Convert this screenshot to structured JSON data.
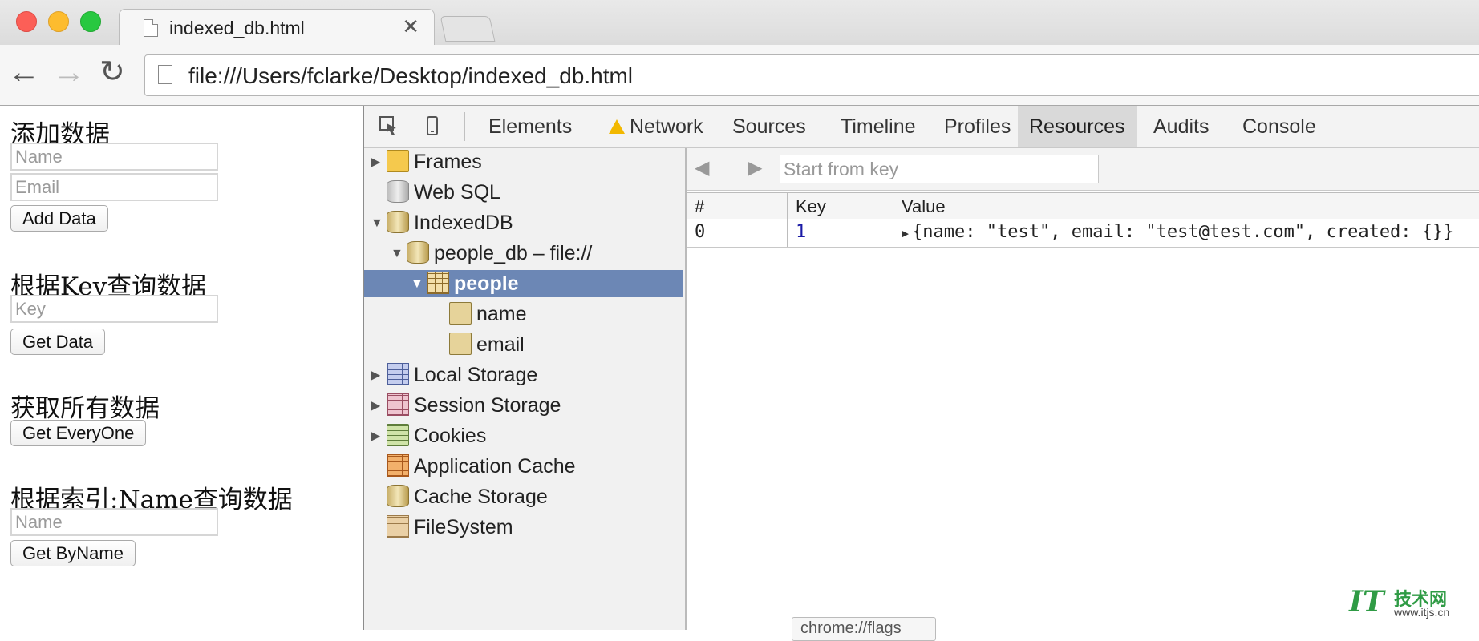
{
  "browser": {
    "tab_title": "indexed_db.html",
    "tab_close": "✕",
    "url": "file:///Users/fclarke/Desktop/indexed_db.html"
  },
  "page": {
    "sections": [
      {
        "heading": "添加数据"
      },
      {
        "heading": "根据Key查询数据"
      },
      {
        "heading": "获取所有数据"
      },
      {
        "heading": "根据索引:Name查询数据"
      }
    ],
    "add_name_placeholder": "Name",
    "add_email_placeholder": "Email",
    "add_button": "Add Data",
    "key_placeholder": "Key",
    "get_button": "Get Data",
    "everyone_button": "Get EveryOne",
    "byname_placeholder": "Name",
    "byname_button": "Get ByName"
  },
  "devtools": {
    "tabs": [
      "Elements",
      "Network",
      "Sources",
      "Timeline",
      "Profiles",
      "Resources",
      "Audits",
      "Console"
    ],
    "active_tab": "Resources",
    "network_warning": true,
    "tree": [
      {
        "label": "Frames",
        "icon": "folder-icon",
        "expanded": false
      },
      {
        "label": "Web SQL",
        "icon": "database-icon"
      },
      {
        "label": "IndexedDB",
        "icon": "database-icon",
        "expanded": true
      },
      {
        "label": "people_db – file://",
        "icon": "database-icon",
        "expanded": true
      },
      {
        "label": "people",
        "icon": "object-store-icon",
        "expanded": true,
        "selected": true
      },
      {
        "label": "name",
        "icon": "index-icon"
      },
      {
        "label": "email",
        "icon": "index-icon"
      },
      {
        "label": "Local Storage",
        "icon": "local-storage-icon",
        "expanded": false
      },
      {
        "label": "Session Storage",
        "icon": "session-storage-icon",
        "expanded": false
      },
      {
        "label": "Cookies",
        "icon": "cookie-icon",
        "expanded": false
      },
      {
        "label": "Application Cache",
        "icon": "app-cache-icon"
      },
      {
        "label": "Cache Storage",
        "icon": "database-icon"
      },
      {
        "label": "FileSystem",
        "icon": "filesystem-icon"
      }
    ],
    "filter_placeholder": "Start from key",
    "grid": {
      "columns": [
        "#",
        "Key",
        "Value"
      ],
      "rows": [
        {
          "index": "0",
          "key": "1",
          "value": "{name: \"test\", email: \"test@test.com\", created: {}}"
        }
      ]
    }
  },
  "tooltip": "chrome://flags",
  "watermark": {
    "logo": "IT",
    "cn": "技术网",
    "url": "www.itjs.cn"
  },
  "colors": {
    "selection": "#6c87b5",
    "key_value": "#1a1aa6",
    "watermark": "#2f9b45"
  }
}
